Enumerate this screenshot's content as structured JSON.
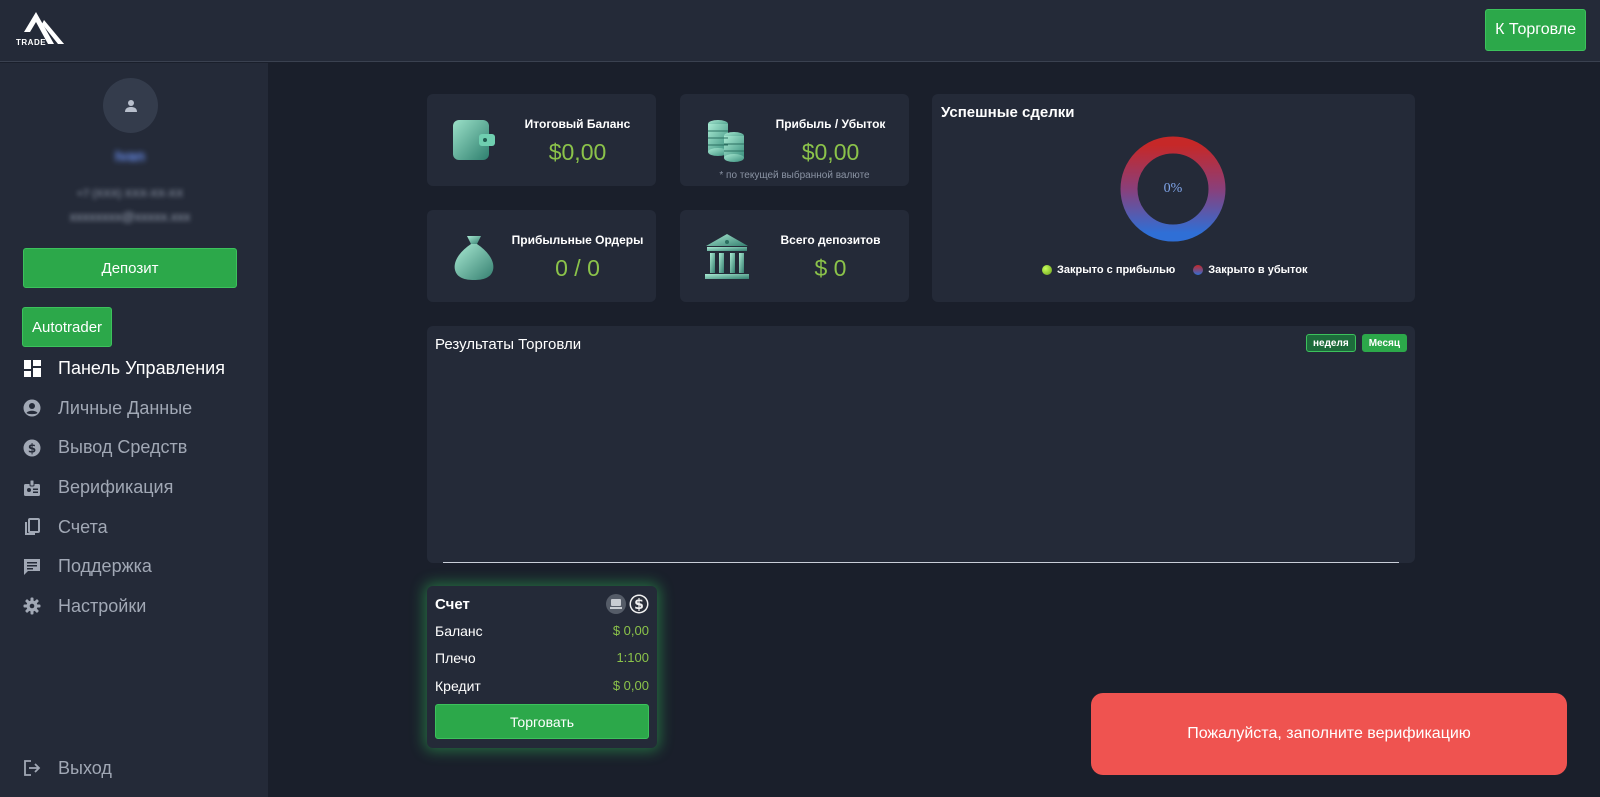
{
  "header": {
    "logo_text": "TRADE",
    "trade_button": "К Торговле"
  },
  "sidebar": {
    "user_name": "Ivan",
    "user_phone": "+7 (XXX) XXX-XX-XX",
    "user_email": "xxxxxxxx@xxxxx.xxx",
    "deposit_button": "Депозит",
    "autotrader_button": "Autotrader",
    "nav": [
      {
        "label": "Панель Управления",
        "icon": "dashboard-icon",
        "active": true
      },
      {
        "label": "Личные Данные",
        "icon": "account-circle-icon",
        "active": false
      },
      {
        "label": "Вывод Средств",
        "icon": "dollar-circle-icon",
        "active": false
      },
      {
        "label": "Верификация",
        "icon": "badge-icon",
        "active": false
      },
      {
        "label": "Счета",
        "icon": "copy-icon",
        "active": false
      },
      {
        "label": "Поддержка",
        "icon": "chat-icon",
        "active": false
      },
      {
        "label": "Настройки",
        "icon": "gear-icon",
        "active": false
      }
    ],
    "logout": "Выход"
  },
  "stats": {
    "balance": {
      "title": "Итоговый Баланс",
      "value": "$0,00"
    },
    "pnl": {
      "title": "Прибыль / Убыток",
      "value": "$0,00",
      "note": "* по текущей выбранной валюте"
    },
    "orders": {
      "title": "Прибыльные Ордеры",
      "value": "0 / 0"
    },
    "deposits": {
      "title": "Всего депозитов",
      "value": "$ 0"
    }
  },
  "deals": {
    "title": "Успешные сделки",
    "percent": "0%",
    "legend": {
      "profit": "Закрыто с прибылью",
      "loss": "Закрыто в убыток"
    }
  },
  "results": {
    "title": "Результаты Торговли",
    "week": "неделя",
    "month": "Месяц"
  },
  "account": {
    "title": "Счет",
    "balance_label": "Баланс",
    "balance_value": "$ 0,00",
    "leverage_label": "Плечо",
    "leverage_value": "1:100",
    "credit_label": "Кредит",
    "credit_value": "$ 0,00",
    "trade_button": "Торговать"
  },
  "toast": {
    "message": "Пожалуйста, заполните верификацию"
  },
  "colors": {
    "accent": "#2ca84a",
    "value": "#8bc34a",
    "panel": "#242a38",
    "background": "#1a1f2b",
    "toast": "#ef5350"
  }
}
